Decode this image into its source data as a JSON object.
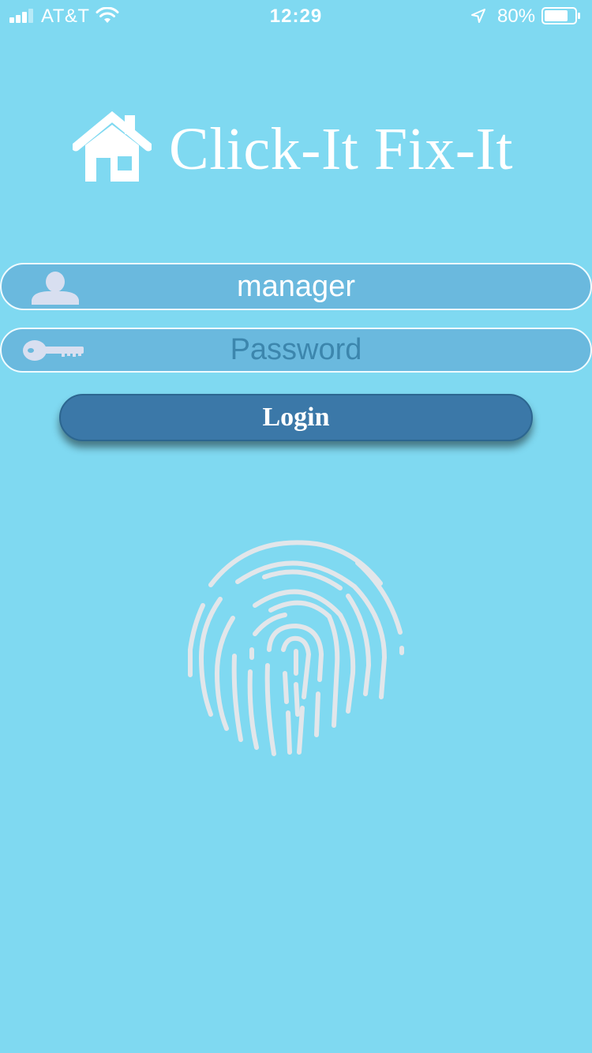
{
  "status_bar": {
    "carrier": "AT&T",
    "time": "12:29",
    "battery_percent": "80%",
    "battery_level": 0.8,
    "signal_bars": 3,
    "icons": [
      "signal-icon",
      "wifi-icon",
      "location-arrow-icon",
      "battery-icon"
    ]
  },
  "app": {
    "title": "Click-It Fix-It",
    "logo_icon": "home-icon"
  },
  "login_form": {
    "username": {
      "value": "manager",
      "icon": "user-icon"
    },
    "password": {
      "placeholder": "Password",
      "value": "",
      "icon": "key-icon"
    },
    "login_label": "Login",
    "biometric_icon": "fingerprint-icon"
  },
  "colors": {
    "background": "#7fd9f1",
    "field_fill": "#6ab9de",
    "button": "#3b78a8",
    "icon_light": "#d8dff0",
    "fingerprint": "#e2e6ea"
  }
}
